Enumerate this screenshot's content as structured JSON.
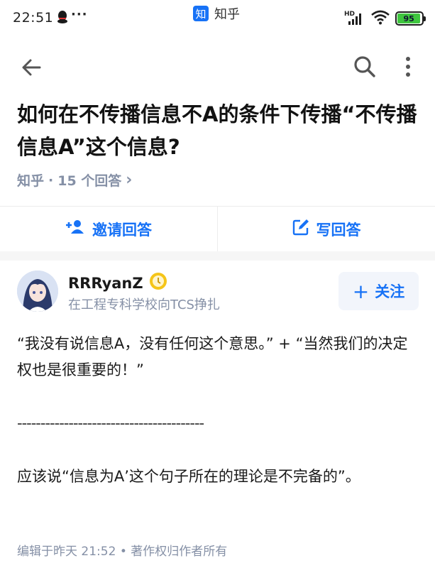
{
  "status_bar": {
    "time": "22:51",
    "dots": "···",
    "app_name": "知乎",
    "app_logo_char": "知",
    "network": "HD",
    "battery": "95",
    "battery_level": 0.95
  },
  "question": {
    "title": "如何在不传播信息不A的条件下传播“不传播信息A”这个信息?",
    "meta_source": "知乎",
    "meta_sep": "·",
    "meta_answers": "15 个回答",
    "meta_chevron": "›"
  },
  "actions": {
    "invite_label": "邀请回答",
    "write_label": "写回答"
  },
  "author": {
    "name": "RRRyanZ",
    "bio": "在工程专科学校向TCS挣扎",
    "follow_label": "关注",
    "follow_plus": "+"
  },
  "answer": {
    "para1": "“我没有说信息A，没有任何这个意思。” + “当然我们的决定权也是很重要的！”",
    "divider": "----------------------------------------",
    "para2": "应该说“信息为A’这个句子所在的理论是不完备的”。"
  },
  "footer": {
    "edited": "编辑于昨天 21:52",
    "sep": "•",
    "copyright": "著作权归作者所有"
  },
  "colors": {
    "accent": "#1772f6",
    "meta": "#8590a6",
    "battery": "#3fc63f"
  }
}
